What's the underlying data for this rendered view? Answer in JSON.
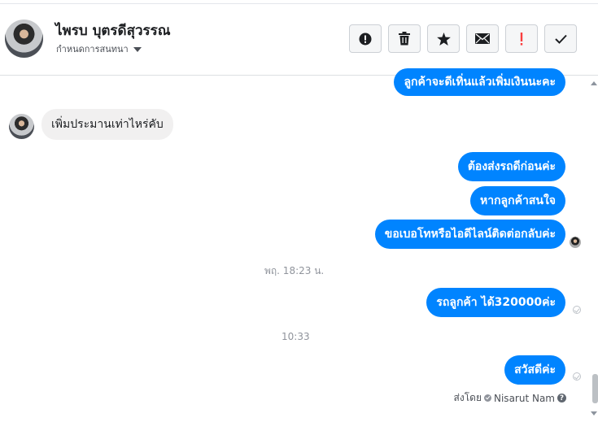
{
  "header": {
    "name": "ไพรบ บุตรดีสุวรรณ",
    "subtitle": "กำหนดการสนทนา",
    "buttons": [
      {
        "icon": "alert-circle-icon"
      },
      {
        "icon": "trash-icon"
      },
      {
        "icon": "star-icon"
      },
      {
        "icon": "envelope-icon"
      },
      {
        "icon": "exclamation-icon",
        "color": "#fa3e3e"
      },
      {
        "icon": "checkmark-icon"
      }
    ]
  },
  "messages": {
    "m0": "ลูกค้าจะดีเทิ่นแล้วเพิ่มเงินนะคะ",
    "m1": "เพิ่มประมานเท่าไหร่คับ",
    "m2": "ต้องส่งรถดีก่อนค่ะ",
    "m3": "หากลูกค้าสนใจ",
    "m4": "ขอเบอโทหรือไอดีไลน์ติดต่อกลับค่ะ",
    "ts1": "พฤ. 18:23 น.",
    "m5": "รถลูกค้า ได้320000ค่ะ",
    "ts2": "10:33",
    "m6": "สวัสดีค่ะ"
  },
  "footer": {
    "sent_by_label": "ส่งโดย",
    "sender": "Nisarut Nam"
  },
  "colors": {
    "outgoing": "#0084ff",
    "incoming": "#f1f0f0"
  }
}
